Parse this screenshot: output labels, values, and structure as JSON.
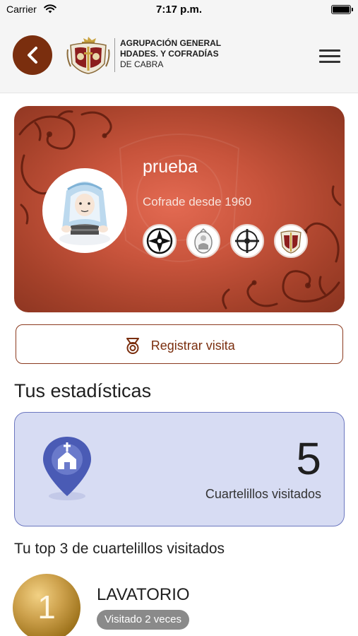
{
  "status_bar": {
    "carrier": "Carrier",
    "time": "7:17 p.m."
  },
  "header": {
    "brand_line1": "AGRUPACIÓN GENERAL",
    "brand_line2": "HDADES. Y COFRADÍAS",
    "brand_line3": "DE CABRA"
  },
  "profile": {
    "name": "prueba",
    "member_since": "Cofrade desde 1960",
    "badges": [
      "cross-emblem-badge",
      "virgin-emblem-badge",
      "cross-circle-emblem-badge",
      "crest-emblem-badge"
    ]
  },
  "register": {
    "label": "Registrar visita"
  },
  "stats": {
    "title": "Tus estadísticas",
    "count": "5",
    "count_label": "Cuartelillos visitados"
  },
  "top3": {
    "title": "Tu top 3 de cuartelillos visitados",
    "items": [
      {
        "rank": "1",
        "name": "LAVATORIO",
        "visits": "Visitado 2 veces"
      }
    ]
  },
  "colors": {
    "brand": "#7a2e0e",
    "card_red": "#c8543c",
    "stats_bg": "#d7dcf3",
    "stats_border": "#6c77bf",
    "pin_blue": "#4a5bb5",
    "medal_gold": "#cda14c",
    "visits_pill": "#8a8a8a"
  }
}
